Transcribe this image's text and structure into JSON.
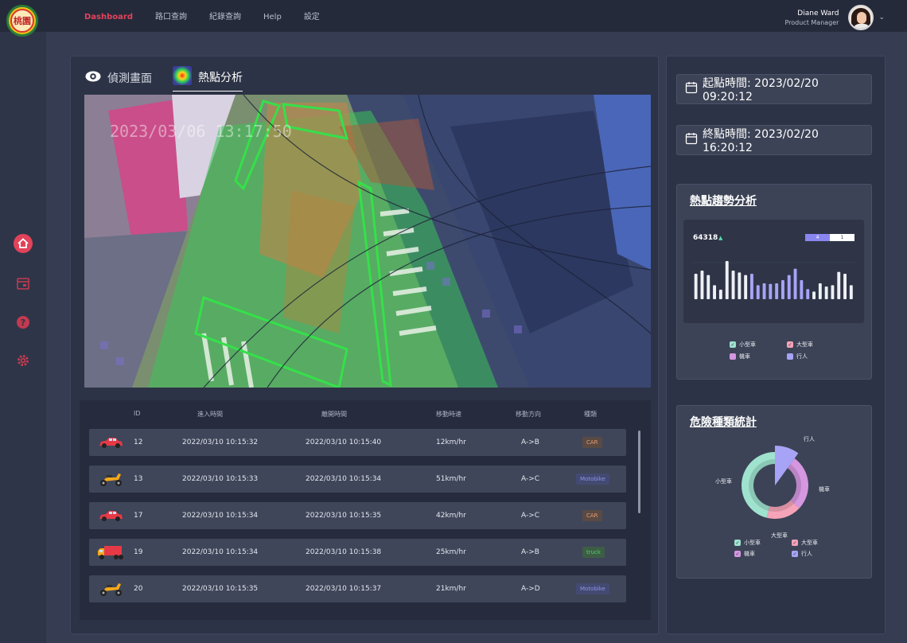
{
  "logo": {
    "text": "桃園"
  },
  "nav": {
    "items": [
      "Dashboard",
      "路口查詢",
      "紀錄查詢",
      "Help",
      "設定"
    ]
  },
  "user": {
    "name": "Diane Ward",
    "role": "Product Manager"
  },
  "tabs": {
    "detect": "偵測畫面",
    "heatmap": "熱點分析"
  },
  "video": {
    "timestamp": "2023/03/06 13:17:50"
  },
  "table": {
    "headers": {
      "id": "ID",
      "enter": "進入時間",
      "leave": "離開時間",
      "speed": "移動時速",
      "direction": "移動方向",
      "type": "種類"
    },
    "rows": [
      {
        "icon": "car-icon",
        "id": "12",
        "enter": "2022/03/10 10:15:32",
        "leave": "2022/03/10 10:15:40",
        "speed": "12km/hr",
        "direction": "A->B",
        "type": "CAR"
      },
      {
        "icon": "scooter-icon",
        "id": "13",
        "enter": "2022/03/10 10:15:33",
        "leave": "2022/03/10 10:15:34",
        "speed": "51km/hr",
        "direction": "A->C",
        "type": "Motobike"
      },
      {
        "icon": "car-icon",
        "id": "17",
        "enter": "2022/03/10 10:15:34",
        "leave": "2022/03/10 10:15:35",
        "speed": "42km/hr",
        "direction": "A->C",
        "type": "CAR"
      },
      {
        "icon": "truck-icon",
        "id": "19",
        "enter": "2022/03/10 10:15:34",
        "leave": "2022/03/10 10:15:38",
        "speed": "25km/hr",
        "direction": "A->B",
        "type": "truck"
      },
      {
        "icon": "scooter-icon",
        "id": "20",
        "enter": "2022/03/10 10:15:35",
        "leave": "2022/03/10 10:15:37",
        "speed": "21km/hr",
        "direction": "A->D",
        "type": "Motobike"
      }
    ]
  },
  "times": {
    "start": "起點時間: 2023/02/20 09:20:12",
    "end": "終點時間: 2023/02/20 16:20:12"
  },
  "trend": {
    "title": "熱點趨勢分析",
    "total_value": "64318",
    "toggle": [
      "4",
      "1"
    ],
    "legend": [
      "小型車",
      "大型車",
      "機車",
      "行人"
    ]
  },
  "danger": {
    "title": "危險種類統計",
    "labels": {
      "pedestrian": "行人",
      "motorcycle": "機車",
      "large": "大型車",
      "small": "小型車"
    },
    "legend": [
      "小型車",
      "大型車",
      "機車",
      "行人"
    ]
  },
  "colors": {
    "accent": "#e2435a",
    "small": "#9fe3cf",
    "large": "#f5a3b8",
    "motorcycle": "#d497e0",
    "pedestrian": "#a7a4f7"
  },
  "chart_data": [
    {
      "type": "bar",
      "title": "熱點趨勢分析",
      "series": [
        {
          "values": [
            40,
            45,
            38,
            22,
            15,
            60,
            45,
            42,
            38,
            40,
            22,
            25,
            24,
            25,
            30,
            38,
            48,
            30,
            16,
            12,
            25,
            20,
            22,
            43,
            40,
            22
          ]
        }
      ],
      "highlight_range": [
        9,
        18
      ]
    },
    {
      "type": "pie",
      "title": "危險種類統計",
      "categories": [
        "行人",
        "機車",
        "大型車",
        "小型車"
      ],
      "values": [
        10,
        27,
        17,
        46
      ]
    }
  ]
}
